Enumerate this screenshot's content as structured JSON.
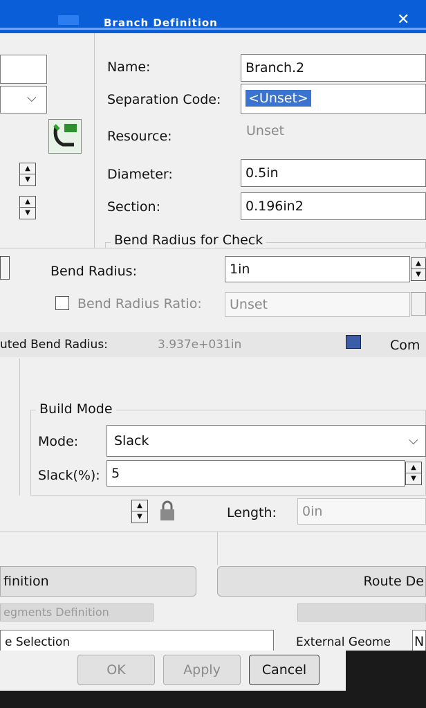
{
  "window": {
    "title": "Branch Definition"
  },
  "properties": {
    "name_label": "Name:",
    "name_value": "Branch.2",
    "separation_code_label": "Separation Code:",
    "separation_code_value": "<Unset>",
    "resource_label": "Resource:",
    "resource_value": "Unset",
    "diameter_label": "Diameter:",
    "diameter_value": "0.5in",
    "section_label": "Section:",
    "section_value": "0.196in2"
  },
  "bend": {
    "group_title": "Bend Radius for Check",
    "radius_label": "Bend Radius:",
    "radius_value": "1in",
    "ratio_label": "Bend Radius Ratio:",
    "ratio_value": "Unset",
    "computed_label": "uted Bend Radius:",
    "computed_value": "3.937e+031in",
    "compute_label": "Com"
  },
  "build_mode": {
    "group_title": "Build Mode",
    "mode_label": "Mode:",
    "mode_value": "Slack",
    "slack_label": "Slack(%):",
    "slack_value": "5"
  },
  "length": {
    "label": "Length:",
    "value": "0in"
  },
  "definitions": {
    "left_button": "finition",
    "right_button": "Route De",
    "segments_tab": "egments Definition"
  },
  "selection": {
    "left_label": "e Selection",
    "right_label": "External Geome",
    "right_value": "N"
  },
  "footer": {
    "ok": "OK",
    "apply": "Apply",
    "cancel": "Cancel"
  }
}
